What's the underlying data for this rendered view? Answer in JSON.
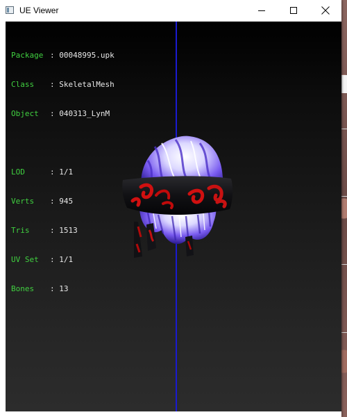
{
  "window": {
    "title": "UE Viewer",
    "icon": "app-window-icon"
  },
  "caption_buttons": [
    {
      "name": "minimize",
      "icon": "minimize-icon"
    },
    {
      "name": "maximize",
      "icon": "maximize-icon"
    },
    {
      "name": "close",
      "icon": "close-icon"
    }
  ],
  "info": {
    "package": {
      "key": "Package",
      "value": "00048995.upk"
    },
    "class": {
      "key": "Class",
      "value": "SkeletalMesh"
    },
    "object": {
      "key": "Object",
      "value": "040313_LynM"
    },
    "lod": {
      "key": "LOD",
      "value": "1/1"
    },
    "verts": {
      "key": "Verts",
      "value": "945"
    },
    "tris": {
      "key": "Tris",
      "value": "1513"
    },
    "uvset": {
      "key": "UV Set",
      "value": "1/1"
    },
    "bones": {
      "key": "Bones",
      "value": "13"
    }
  },
  "colors": {
    "info_label": "#40d040",
    "info_value": "#e8e8e8",
    "axis_line": "#1a1ad0",
    "viewport_top": "#000000",
    "viewport_bottom": "#2c2c2c"
  }
}
